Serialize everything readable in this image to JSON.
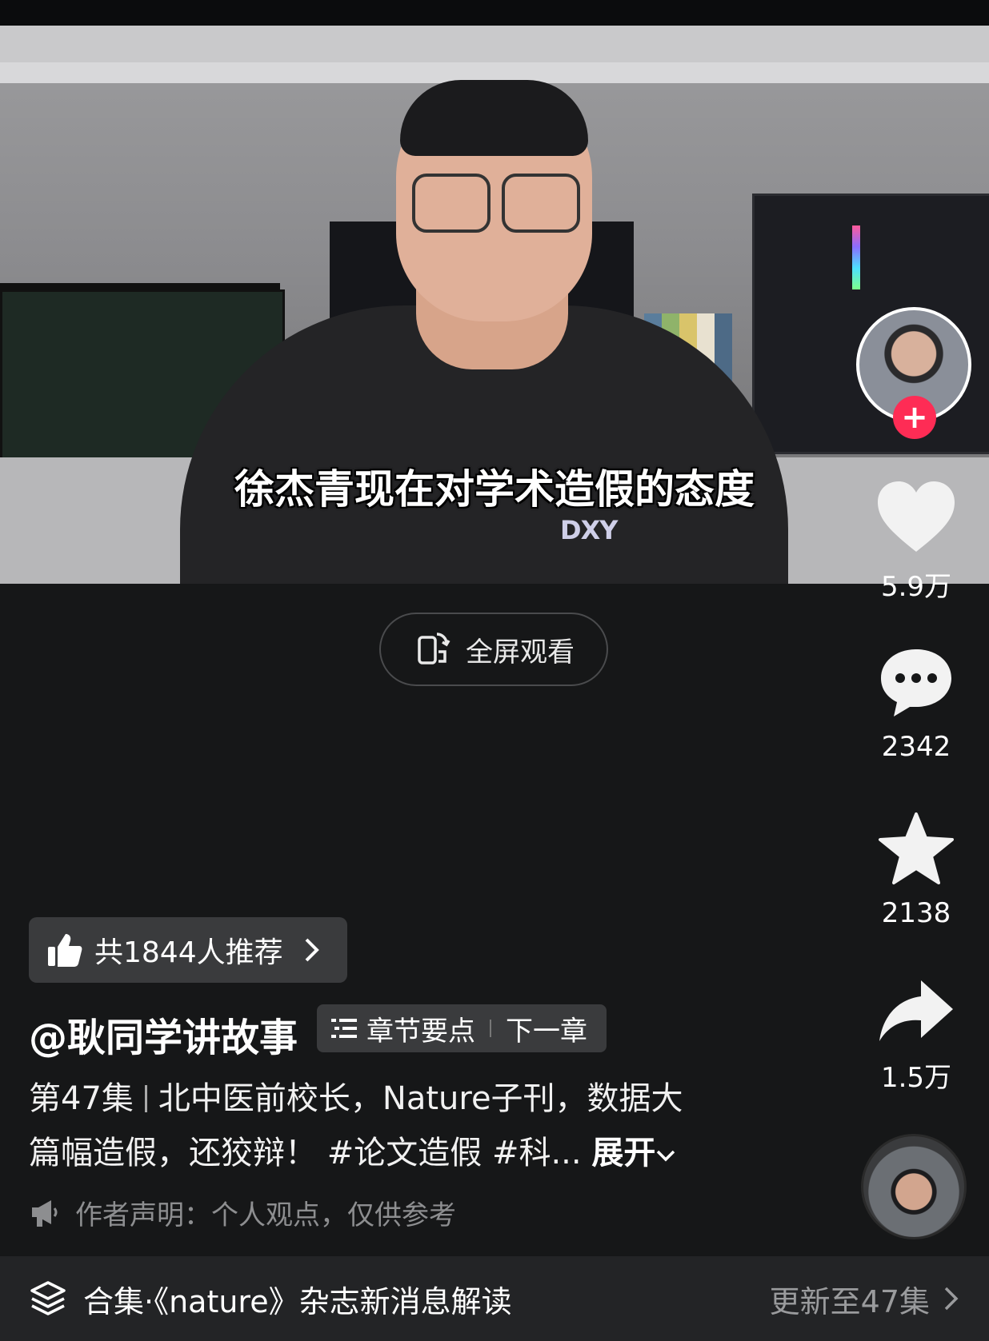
{
  "video": {
    "subtitle": "徐杰青现在对学术造假的态度",
    "shirt_logo": "DXY"
  },
  "fullscreen": {
    "label": "全屏观看"
  },
  "sidebar": {
    "likes": "5.9万",
    "comments": "2342",
    "favorites": "2138",
    "shares": "1.5万"
  },
  "recommend": {
    "label": "共1844人推荐"
  },
  "author": {
    "name": "@耿同学讲故事"
  },
  "chapter": {
    "points_label": "章节要点",
    "next_label": "下一章"
  },
  "description": {
    "episode": "第47集",
    "text_line1": "北中医前校长，Nature子刊，数据大",
    "text_line2": "篇幅造假，还狡辩！ #论文造假 #科...",
    "expand": "展开"
  },
  "statement": {
    "text": "作者声明：个人观点，仅供参考"
  },
  "collection": {
    "title": "合集·《nature》杂志新消息解读",
    "update": "更新至47集"
  },
  "colors": {
    "accent": "#fe2c55",
    "background": "#161718"
  }
}
